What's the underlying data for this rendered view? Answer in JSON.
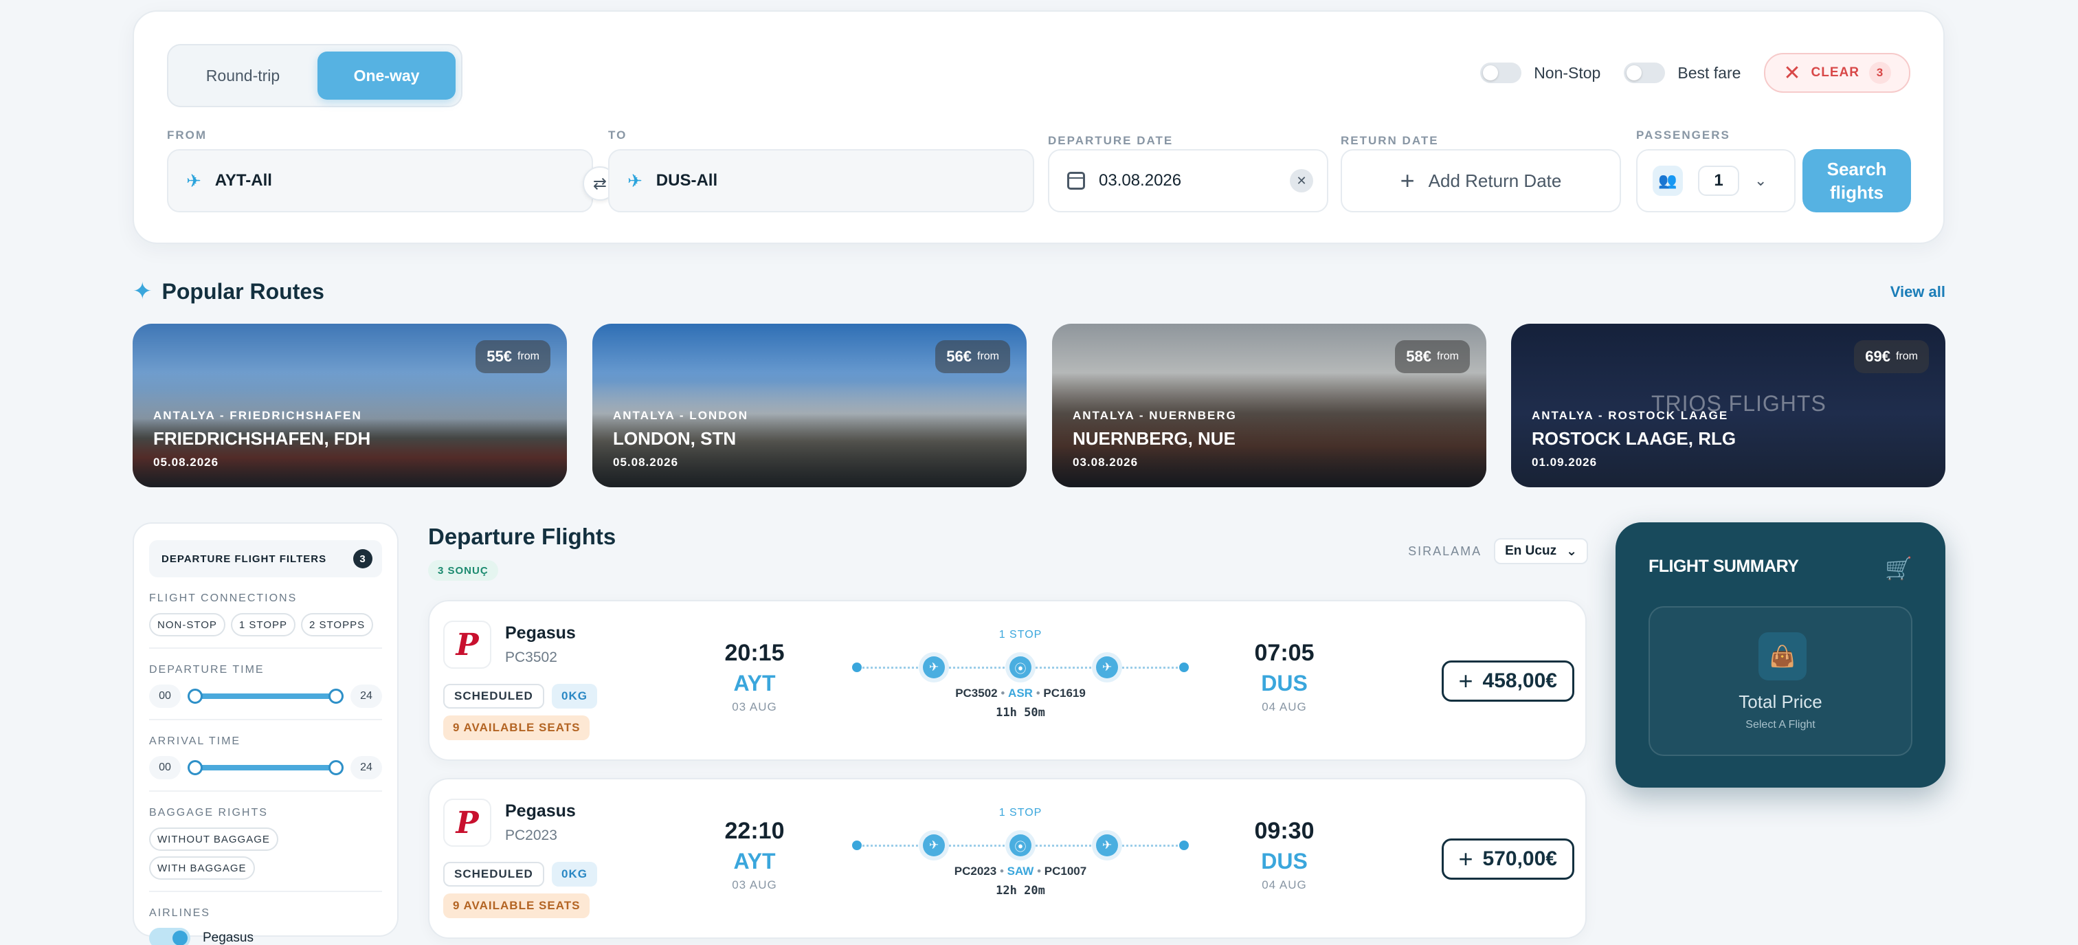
{
  "search": {
    "trip_types": [
      "Round-trip",
      "One-way"
    ],
    "active_trip": "One-way",
    "non_stop_label": "Non-Stop",
    "best_fare_label": "Best fare",
    "clear_label": "CLEAR",
    "clear_count": "3",
    "from_label": "FROM",
    "from_value": "AYT-All",
    "to_label": "TO",
    "to_value": "DUS-All",
    "departure_label": "DEPARTURE DATE",
    "departure_value": "03.08.2026",
    "return_label": "RETURN DATE",
    "return_placeholder": "Add Return Date",
    "passengers_label": "PASSENGERS",
    "passengers_value": "1",
    "search_label": "Search flights"
  },
  "popular": {
    "title": "Popular Routes",
    "view_all": "View all",
    "routes": [
      {
        "price": "55€",
        "from": "from",
        "sub": "ANTALYA - FRIEDRICHSHAFEN",
        "city": "FRIEDRICHSHAFEN, FDH",
        "date": "05.08.2026"
      },
      {
        "price": "56€",
        "from": "from",
        "sub": "ANTALYA - LONDON",
        "city": "LONDON, STN",
        "date": "05.08.2026"
      },
      {
        "price": "58€",
        "from": "from",
        "sub": "ANTALYA - NUERNBERG",
        "city": "NUERNBERG, NUE",
        "date": "03.08.2026"
      },
      {
        "price": "69€",
        "from": "from",
        "sub": "ANTALYA - ROSTOCK LAAGE",
        "city": "ROSTOCK LAAGE, RLG",
        "date": "01.09.2026",
        "watermark": "TRIOS FLIGHTS"
      }
    ]
  },
  "filters": {
    "title": "DEPARTURE FLIGHT FILTERS",
    "count": "3",
    "connections_label": "FLIGHT CONNECTIONS",
    "connections": [
      "NON-STOP",
      "1 STOPP",
      "2 STOPPS"
    ],
    "departure_label": "DEPARTURE TIME",
    "departure_min": "00",
    "departure_max": "24",
    "arrival_label": "ARRIVAL TIME",
    "arrival_min": "00",
    "arrival_max": "24",
    "baggage_label": "BAGGAGE RIGHTS",
    "baggage": [
      "WITHOUT BAGGAGE",
      "WITH BAGGAGE"
    ],
    "airlines_label": "AIRLINES",
    "airline": "Pegasus"
  },
  "results": {
    "title": "Departure Flights",
    "count": "3 SONUÇ",
    "sort_label": "SIRALAMA",
    "sort_value": "En Ucuz",
    "flights": [
      {
        "logo": "P",
        "airline": "Pegasus",
        "number": "PC3502",
        "status": "SCHEDULED",
        "baggage": "0KG",
        "seats": "9 AVAILABLE SEATS",
        "dep_time": "20:15",
        "dep_code": "AYT",
        "dep_day": "03 AUG",
        "stops": "1 STOP",
        "leg1": "PC3502",
        "via": "ASR",
        "leg2": "PC1619",
        "duration": "11h 50m",
        "arr_time": "07:05",
        "arr_code": "DUS",
        "arr_day": "04 AUG",
        "price": "458,00€"
      },
      {
        "logo": "P",
        "airline": "Pegasus",
        "number": "PC2023",
        "status": "SCHEDULED",
        "baggage": "0KG",
        "seats": "9 AVAILABLE SEATS",
        "dep_time": "22:10",
        "dep_code": "AYT",
        "dep_day": "03 AUG",
        "stops": "1 STOP",
        "leg1": "PC2023",
        "via": "SAW",
        "leg2": "PC1007",
        "duration": "12h 20m",
        "arr_time": "09:30",
        "arr_code": "DUS",
        "arr_day": "04 AUG",
        "price": "570,00€"
      }
    ]
  },
  "summary": {
    "title": "FLIGHT SUMMARY",
    "total_label": "Total Price",
    "hint": "Select A Flight"
  }
}
